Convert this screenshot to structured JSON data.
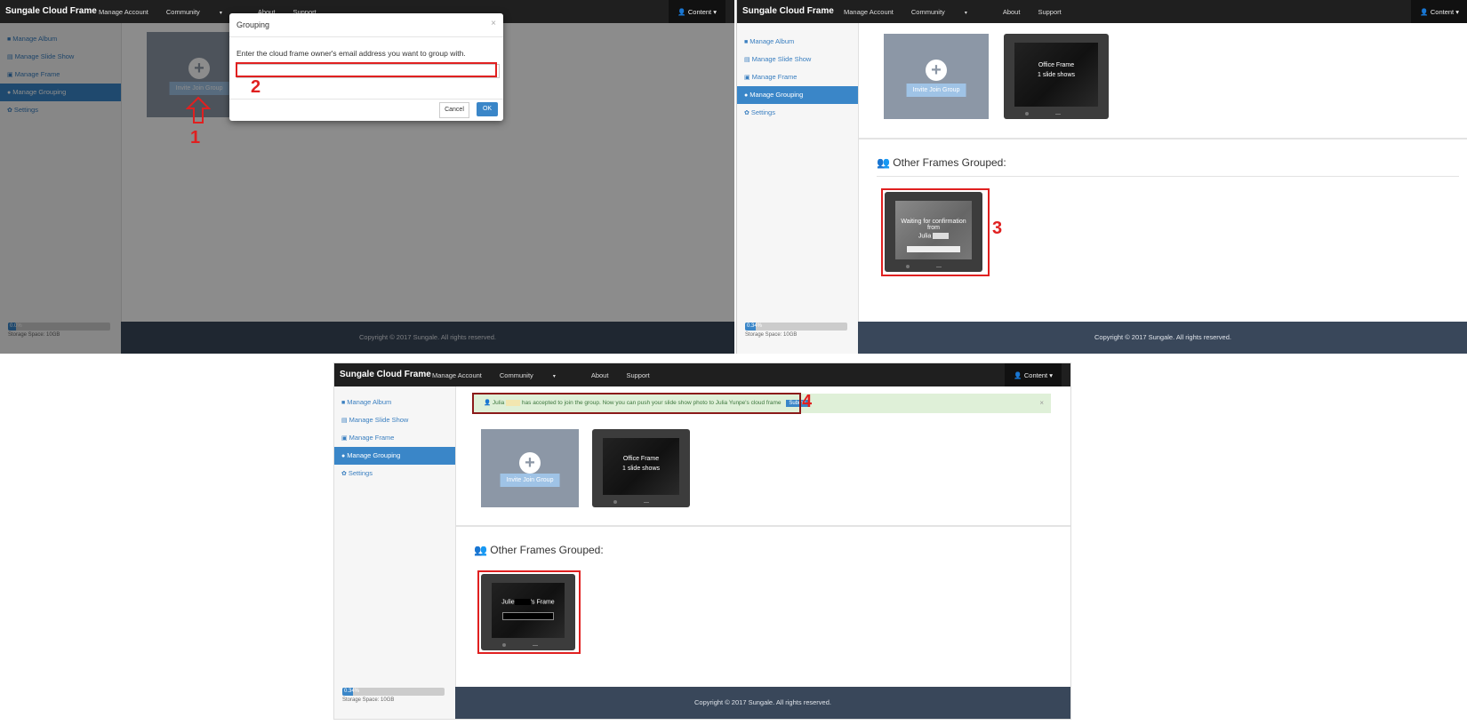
{
  "app": {
    "brand": "Sungale Cloud Frame",
    "nav": [
      "Manage Account",
      "Community",
      "About",
      "Support"
    ],
    "user_menu": "Content",
    "sidebar": [
      "Manage Album",
      "Manage Slide Show",
      "Manage Frame",
      "Manage Grouping",
      "Settings"
    ],
    "active_sidebar": "Manage Grouping",
    "storage_pct_a": "0.0%",
    "storage_pct_b": "0.34%",
    "storage_pct_c": "0.34%",
    "storage_label": "Storage Space: 10GB",
    "footer": "Copyright © 2017 Sungale. All rights reserved."
  },
  "panelA": {
    "invite_label": "Invite Join Group",
    "modal": {
      "title": "Grouping",
      "close": "×",
      "prompt": "Enter the cloud frame owner's email address you want to group with.",
      "input_value": "",
      "cancel": "Cancel",
      "ok": "OK"
    },
    "step1": "1",
    "step2": "2"
  },
  "panelB": {
    "invite_label": "Invite Join Group",
    "own_frame": {
      "name": "Office Frame",
      "slides": "1 slide shows"
    },
    "section_title": "Other Frames Grouped:",
    "pending": {
      "line1": "Waiting for confirmation from",
      "line2": "Julia"
    },
    "step3": "3"
  },
  "panelC": {
    "alert": {
      "prefix": "Julia",
      "message": "has accepted to join the group. Now you can push your slide show photo to Julia Yunpe's cloud frame",
      "badge": "Submit",
      "close": "×"
    },
    "invite_label": "Invite Join Group",
    "own_frame": {
      "name": "Office Frame",
      "slides": "1 slide shows"
    },
    "section_title": "Other Frames Grouped:",
    "grouped": {
      "line1a": "Julie",
      "line1b": "'s Frame"
    },
    "step4": "4"
  }
}
